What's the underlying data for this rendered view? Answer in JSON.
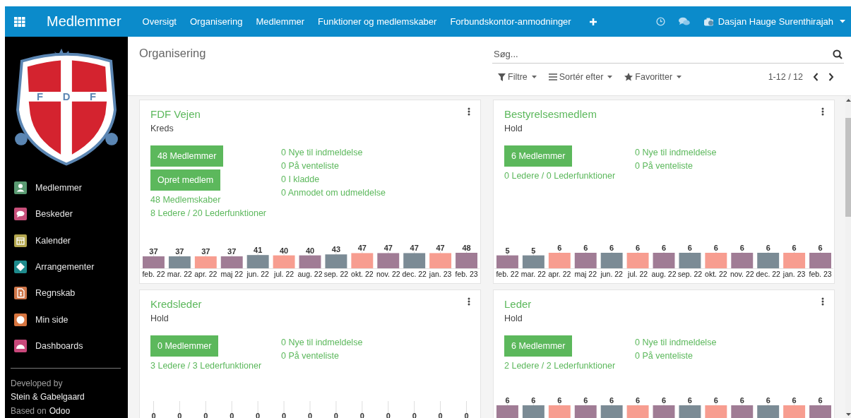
{
  "navbar": {
    "app_title": "Medlemmer",
    "menu": [
      "Oversigt",
      "Organisering",
      "Medlemmer",
      "Funktioner og medlemskaber",
      "Forbundskontor-anmodninger"
    ],
    "user": "Dasjan Hauge Surenthirajah"
  },
  "sidebar": {
    "logo_letters": [
      "F",
      "D",
      "F"
    ],
    "items": [
      {
        "label": "Medlemmer",
        "kind": "person",
        "color": "#5a9a72"
      },
      {
        "label": "Beskeder",
        "kind": "chat",
        "color": "#c84f7a"
      },
      {
        "label": "Kalender",
        "kind": "calendar",
        "color": "#b3a64e"
      },
      {
        "label": "Arrangementer",
        "kind": "ticket",
        "color": "#1e8a8c"
      },
      {
        "label": "Regnskab",
        "kind": "document",
        "color": "#cf7649"
      },
      {
        "label": "Min side",
        "kind": "globe",
        "color": "#d7753f"
      },
      {
        "label": "Dashboards",
        "kind": "gauge",
        "color": "#c9487b"
      }
    ],
    "footer": {
      "developed_label": "Developed by",
      "developer": "Stein & Gabelgaard",
      "based_label": "Based on",
      "based_link": "Odoo"
    }
  },
  "control_panel": {
    "breadcrumb": "Organisering",
    "search": {
      "placeholder": "Søg..."
    },
    "filters": [
      {
        "label": "Filtre",
        "kind": "filter"
      },
      {
        "label": "Sortér efter",
        "kind": "sort"
      },
      {
        "label": "Favoritter",
        "kind": "star"
      }
    ],
    "pager": "1-12 / 12"
  },
  "cards": [
    {
      "title": "FDF Vejen",
      "type": "Kreds",
      "buttons": [
        "48 Medlemmer",
        "Opret medlem"
      ],
      "left_links": [
        "48 Medlemskaber",
        "8 Ledere / 20 Lederfunktioner"
      ],
      "right_links": [
        "0 Nye til indmeldelse",
        "0 På venteliste",
        "0 I kladde",
        "0 Anmodet om udmeldelse"
      ],
      "chart_data": {
        "type": "bar",
        "data_labels": true,
        "grid": true,
        "categories": [
          "feb. 22",
          "mar. 22",
          "apr. 22",
          "maj 22",
          "jun. 22",
          "jul. 22",
          "aug. 22",
          "sep. 22",
          "okt. 22",
          "nov. 22",
          "dec. 22",
          "jan. 23",
          "feb. 23"
        ],
        "values": [
          37,
          37,
          37,
          37,
          41,
          40,
          40,
          43,
          47,
          47,
          47,
          47,
          48
        ]
      }
    },
    {
      "title": "Bestyrelsesmedlem",
      "type": "Hold",
      "buttons": [
        "6 Medlemmer"
      ],
      "left_links": [
        "0 Ledere / 0 Lederfunktioner"
      ],
      "right_links": [
        "0 Nye til indmeldelse",
        "0 På venteliste"
      ],
      "chart_data": {
        "type": "bar",
        "data_labels": true,
        "grid": true,
        "categories": [
          "feb. 22",
          "mar. 22",
          "apr. 22",
          "maj 22",
          "jun. 22",
          "jul. 22",
          "aug. 22",
          "sep. 22",
          "okt. 22",
          "nov. 22",
          "dec. 22",
          "jan. 23",
          "feb. 23"
        ],
        "values": [
          5,
          5,
          6,
          6,
          6,
          6,
          6,
          6,
          6,
          6,
          6,
          6,
          6
        ]
      }
    },
    {
      "title": "Kredsleder",
      "type": "Hold",
      "buttons": [
        "0 Medlemmer"
      ],
      "left_links": [
        "3 Ledere / 3 Lederfunktioner"
      ],
      "right_links": [
        "0 Nye til indmeldelse",
        "0 På venteliste"
      ],
      "bar_value_labels": [
        "0",
        "0",
        "0",
        "0",
        "0",
        "0",
        "0",
        "0",
        "0",
        "0",
        "0",
        "0",
        "0"
      ]
    },
    {
      "title": "Leder",
      "type": "Hold",
      "buttons": [
        "6 Medlemmer"
      ],
      "left_links": [
        "2 Ledere / 2 Lederfunktioner"
      ],
      "right_links": [
        "0 Nye til indmeldelse",
        "0 På venteliste"
      ],
      "chart_data": {
        "type": "bar",
        "data_labels": true,
        "grid": true,
        "categories": [
          null,
          null,
          null,
          null,
          null,
          null,
          null,
          null,
          null,
          null,
          null,
          null,
          null
        ],
        "values": [
          6,
          6,
          6,
          6,
          6,
          6,
          6,
          6,
          6,
          6,
          6,
          6,
          6
        ]
      }
    }
  ]
}
